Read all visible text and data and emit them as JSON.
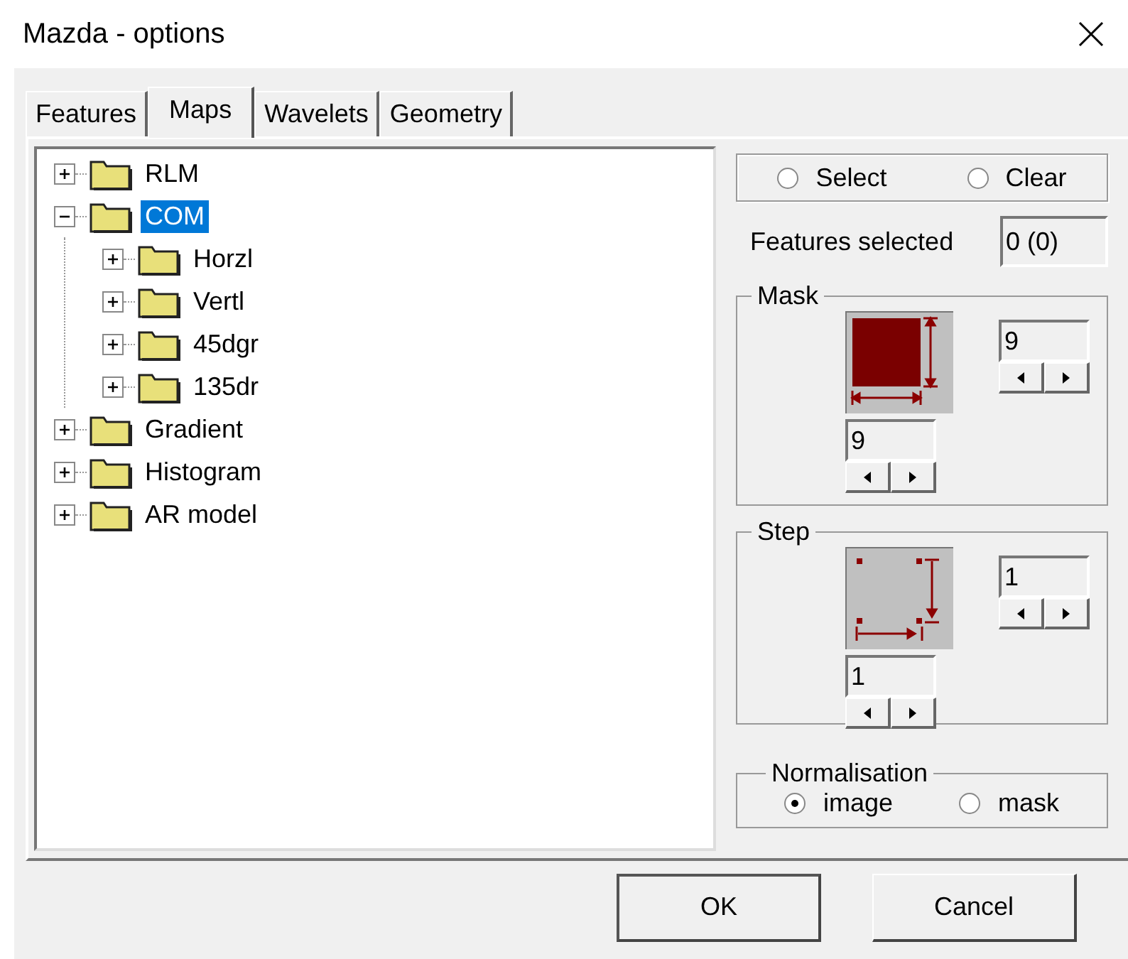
{
  "window": {
    "title": "Mazda - options"
  },
  "tabs": [
    {
      "label": "Features",
      "selected": false
    },
    {
      "label": "Maps",
      "selected": true
    },
    {
      "label": "Wavelets",
      "selected": false
    },
    {
      "label": "Geometry",
      "selected": false
    }
  ],
  "tree": [
    {
      "label": "RLM",
      "expanded": false,
      "selected": false
    },
    {
      "label": "COM",
      "expanded": true,
      "selected": true,
      "children": [
        {
          "label": "Horzl",
          "expanded": false,
          "selected": false
        },
        {
          "label": "Vertl",
          "expanded": false,
          "selected": false
        },
        {
          "label": "45dgr",
          "expanded": false,
          "selected": false
        },
        {
          "label": "135dr",
          "expanded": false,
          "selected": false
        }
      ]
    },
    {
      "label": "Gradient",
      "expanded": false,
      "selected": false
    },
    {
      "label": "Histogram",
      "expanded": false,
      "selected": false
    },
    {
      "label": "AR model",
      "expanded": false,
      "selected": false
    }
  ],
  "selection": [
    {
      "label": "Select",
      "selected": false
    },
    {
      "label": "Clear",
      "selected": false
    }
  ],
  "features_selected": {
    "label": "Features selected",
    "value": "0 (0)"
  },
  "groups": [
    {
      "kind": "mask",
      "title": "Mask",
      "vertical_value": "9",
      "horizontal_value": "9"
    },
    {
      "kind": "step",
      "title": "Step",
      "vertical_value": "1",
      "horizontal_value": "1"
    }
  ],
  "normalisation": {
    "title": "Normalisation",
    "options": [
      {
        "label": "image",
        "selected": true
      },
      {
        "label": "mask",
        "selected": false
      }
    ]
  },
  "buttons": [
    {
      "label": "OK",
      "default": true
    },
    {
      "label": "Cancel",
      "default": false
    }
  ]
}
